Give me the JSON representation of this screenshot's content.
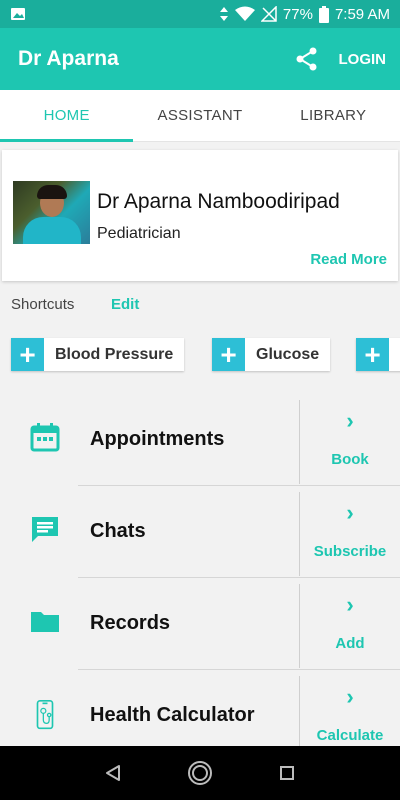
{
  "status_bar": {
    "battery": "77%",
    "time": "7:59 AM"
  },
  "app_bar": {
    "title": "Dr Aparna",
    "login": "LOGIN"
  },
  "tabs": [
    {
      "label": "HOME",
      "active": true
    },
    {
      "label": "ASSISTANT",
      "active": false
    },
    {
      "label": "LIBRARY",
      "active": false
    }
  ],
  "doctor": {
    "name": "Dr Aparna Namboodiripad",
    "role": "Pediatrician",
    "read_more": "Read More"
  },
  "shortcuts": {
    "label": "Shortcuts",
    "edit": "Edit",
    "items": [
      "Blood Pressure",
      "Glucose",
      ""
    ]
  },
  "features": [
    {
      "title": "Appointments",
      "action": "Book",
      "icon": "calendar-icon"
    },
    {
      "title": "Chats",
      "action": "Subscribe",
      "icon": "chat-icon"
    },
    {
      "title": "Records",
      "action": "Add",
      "icon": "folder-icon"
    },
    {
      "title": "Health Calculator",
      "action": "Calculate",
      "icon": "health-calculator-icon"
    }
  ],
  "colors": {
    "primary": "#1ec6b1",
    "status_bar": "#1aae9c",
    "chip_plus": "#2dbfd6"
  }
}
